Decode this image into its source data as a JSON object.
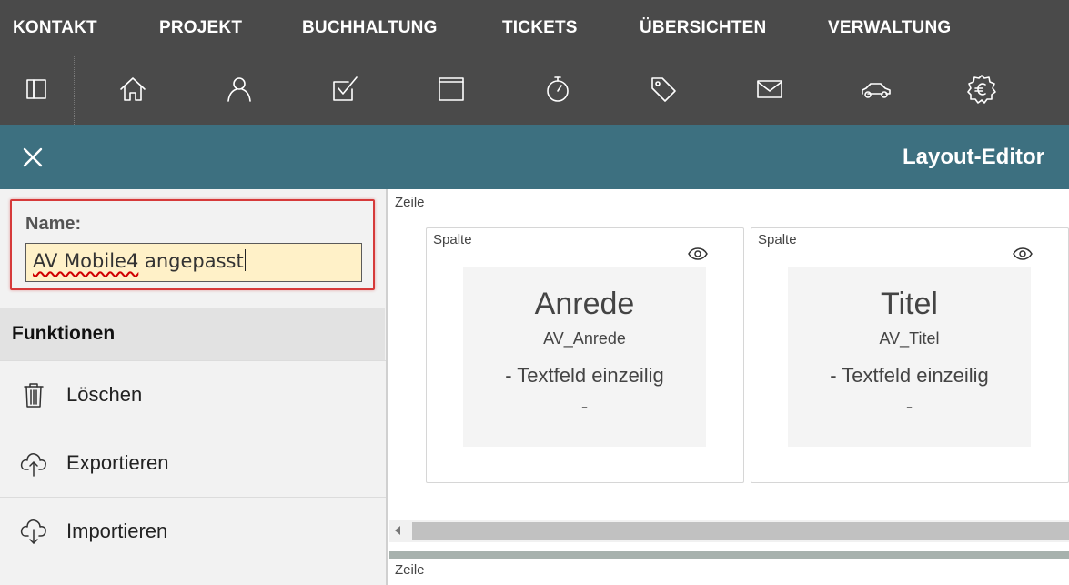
{
  "menu": {
    "items": [
      {
        "label": "KONTAKT"
      },
      {
        "label": "PROJEKT"
      },
      {
        "label": "BUCHHALTUNG"
      },
      {
        "label": "TICKETS"
      },
      {
        "label": "ÜBERSICHTEN"
      },
      {
        "label": "VERWALTUNG"
      }
    ]
  },
  "toolbar": {
    "icons": [
      "sidebar-toggle-icon",
      "home-icon",
      "contact-person-icon",
      "task-checkbox-icon",
      "window-icon",
      "timer-icon",
      "tag-icon",
      "mail-icon",
      "car-icon",
      "euro-gear-icon"
    ]
  },
  "titlebar": {
    "title": "Layout-Editor",
    "close_icon": "close-icon",
    "background": "#3d7080"
  },
  "name_section": {
    "label": "Name:",
    "value_misspelled": "AV Mobile4",
    "value_rest": " angepasst"
  },
  "functions": {
    "header": "Funktionen",
    "items": [
      {
        "label": "Löschen",
        "icon": "trash-icon"
      },
      {
        "label": "Exportieren",
        "icon": "cloud-upload-icon"
      },
      {
        "label": "Importieren",
        "icon": "cloud-download-icon"
      }
    ]
  },
  "canvas": {
    "row_label": "Zeile",
    "columns": [
      {
        "label": "Spalte",
        "field": {
          "title": "Anrede",
          "key": "AV_Anrede",
          "type": "- Textfeld einzeilig",
          "extra": "-"
        }
      },
      {
        "label": "Spalte",
        "field": {
          "title": "Titel",
          "key": "AV_Titel",
          "type": "- Textfeld einzeilig",
          "extra": "-"
        }
      }
    ],
    "row_label_2": "Zeile"
  }
}
